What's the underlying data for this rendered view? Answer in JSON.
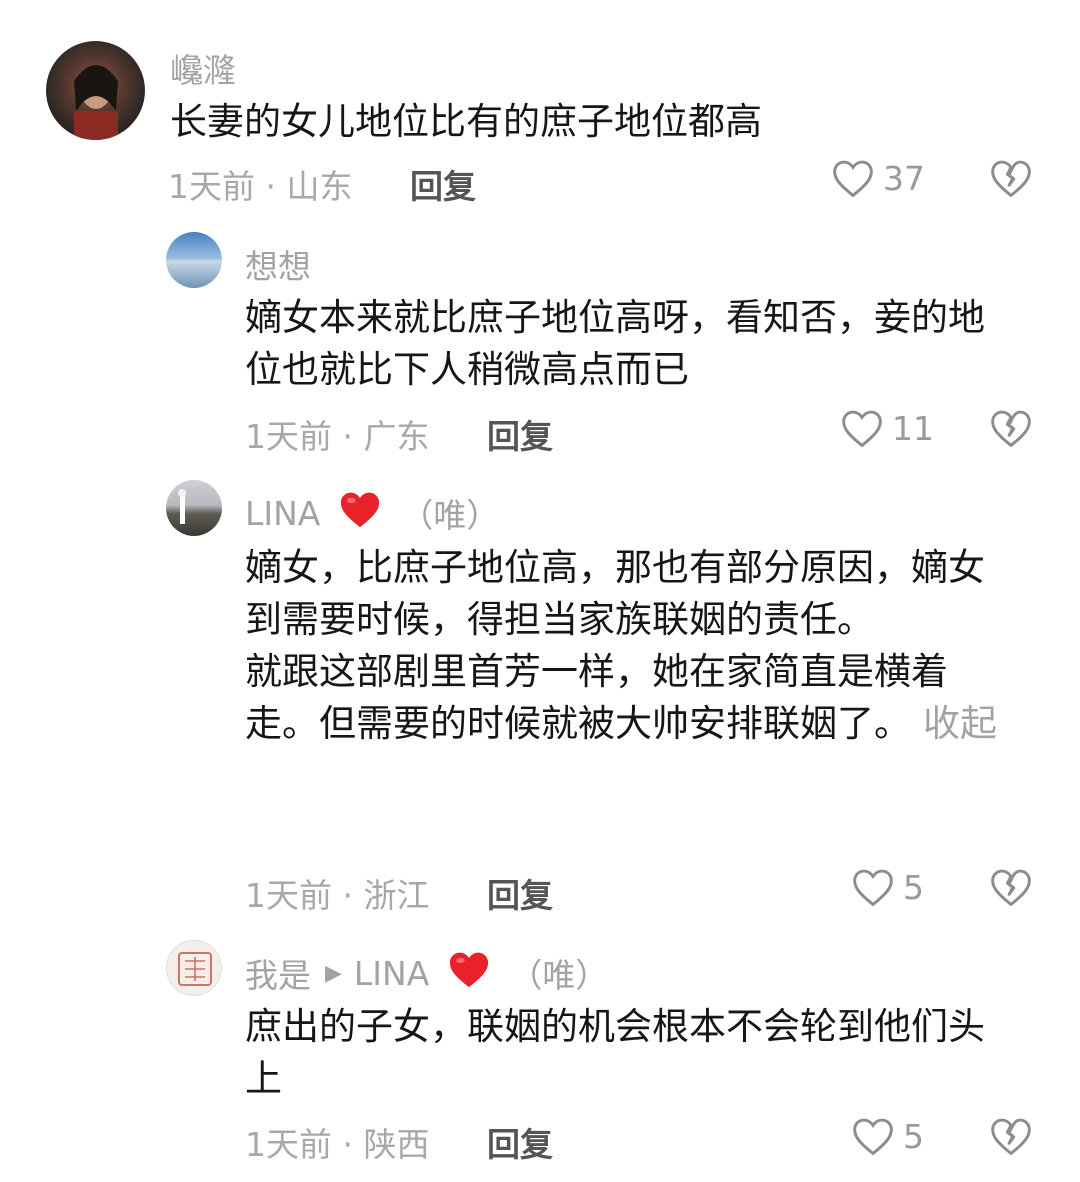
{
  "colors": {
    "text": "#161616",
    "muted": "#a3a3a3",
    "heart_red": "#e8212b"
  },
  "comments": [
    {
      "username": "巉漋",
      "text": "长妻的女儿地位比有的庶子地位都高",
      "time_location": "1天前 · 山东",
      "reply_label": "回复",
      "likes": "37"
    },
    {
      "username": "想想",
      "text": "嫡女本来就比庶子地位高呀，看知否，妾的地位也就比下人稍微高点而已",
      "time_location": "1天前 · 广东",
      "reply_label": "回复",
      "likes": "11"
    },
    {
      "username": "LINA",
      "tag": "（唯）",
      "text_lines": [
        "嫡女，比庶子地位高，那也有部分原因，嫡女到需要时候，得担当家族联姻的责任。",
        "就跟这部剧里首芳一样，她在家简直是横着走。但需要的时候就被大帅安排联姻了。"
      ],
      "collapse_label": "收起",
      "time_location": "1天前 · 浙江",
      "reply_label": "回复",
      "likes": "5"
    },
    {
      "username": "我是",
      "reply_to": "LINA",
      "tag": "（唯）",
      "text": "庶出的子女，联姻的机会根本不会轮到他们头上",
      "time_location": "1天前 · 陕西",
      "reply_label": "回复",
      "likes": "5"
    }
  ]
}
